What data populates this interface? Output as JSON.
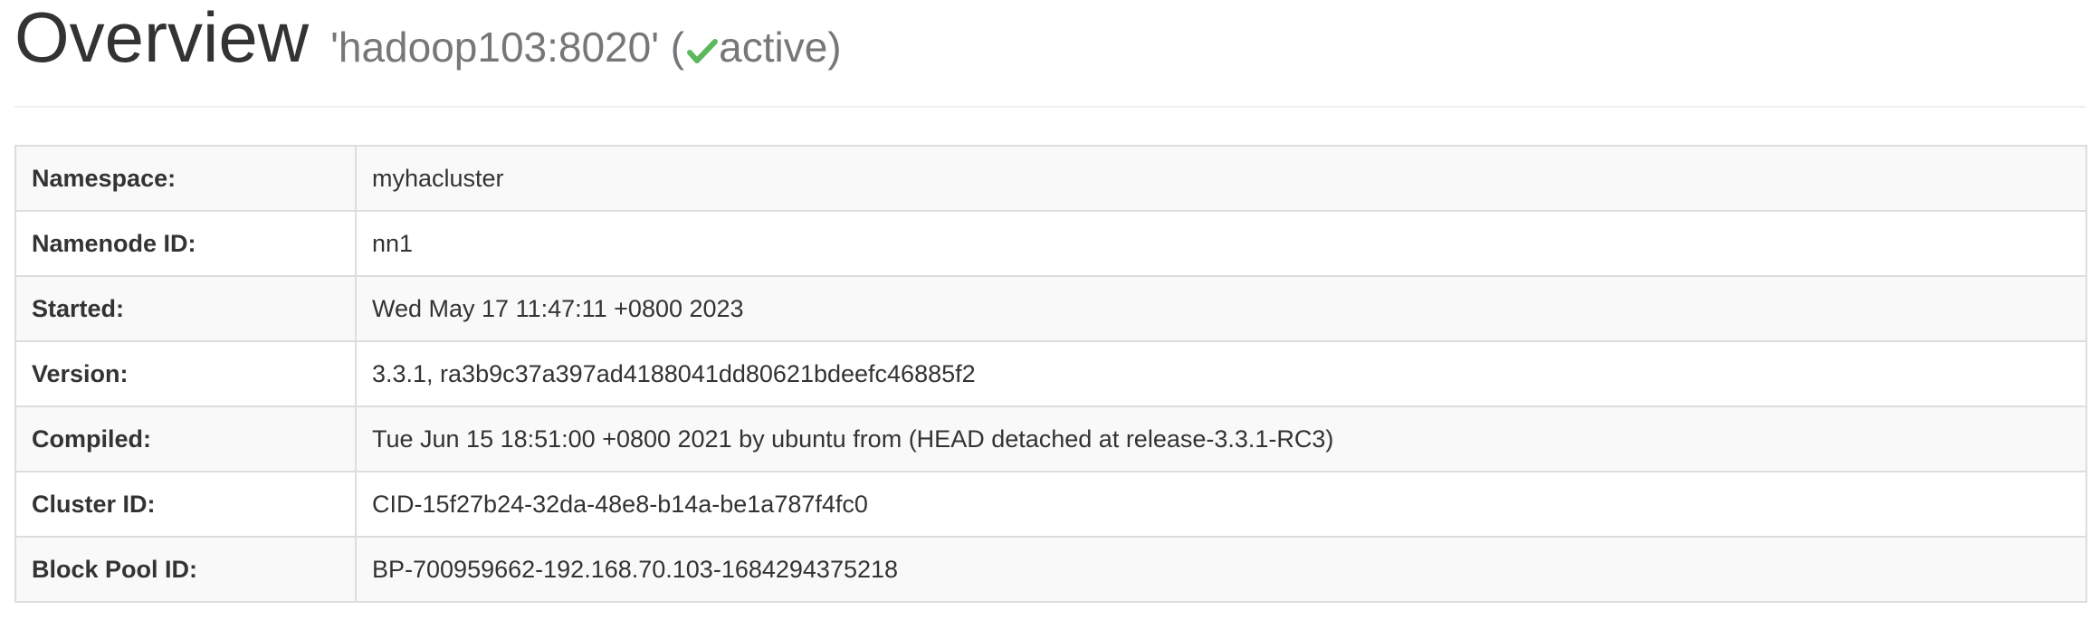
{
  "header": {
    "title": "Overview",
    "host": "'hadoop103:8020'",
    "open_paren": " (",
    "state": "active",
    "close_paren": ")",
    "state_icon": "check-icon",
    "state_icon_color": "#5cb85c"
  },
  "overview": {
    "rows": [
      {
        "key": "Namespace:",
        "value": "myhacluster"
      },
      {
        "key": "Namenode ID:",
        "value": "nn1"
      },
      {
        "key": "Started:",
        "value": "Wed May 17 11:47:11 +0800 2023"
      },
      {
        "key": "Version:",
        "value": "3.3.1, ra3b9c37a397ad4188041dd80621bdeefc46885f2"
      },
      {
        "key": "Compiled:",
        "value": "Tue Jun 15 18:51:00 +0800 2021 by ubuntu from (HEAD detached at release-3.3.1-RC3)"
      },
      {
        "key": "Cluster ID:",
        "value": "CID-15f27b24-32da-48e8-b14a-be1a787f4fc0"
      },
      {
        "key": "Block Pool ID:",
        "value": "BP-700959662-192.168.70.103-1684294375218"
      }
    ]
  }
}
